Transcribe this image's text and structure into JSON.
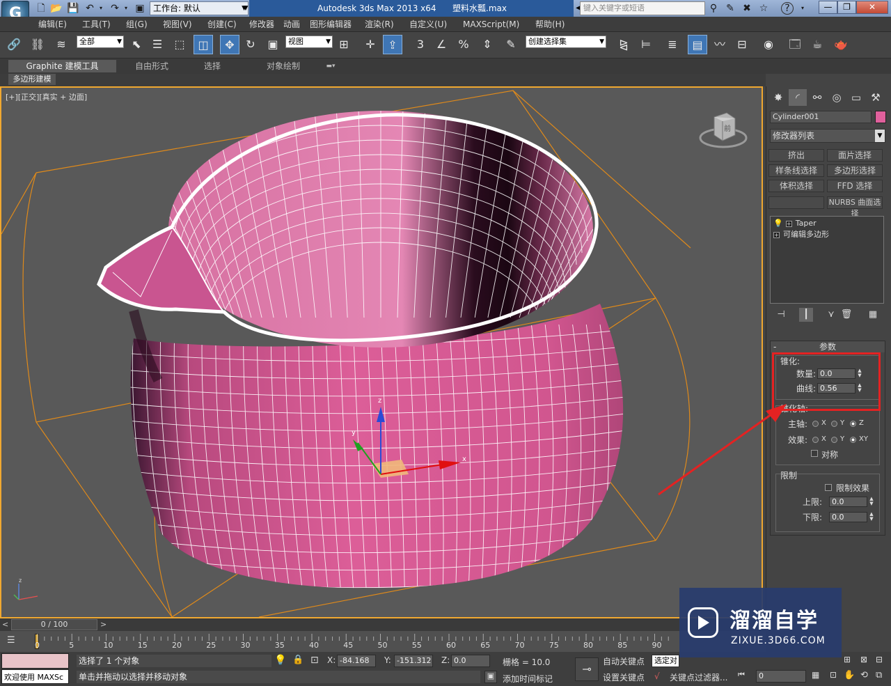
{
  "titlebar": {
    "workspace_label": "工作台: 默认",
    "app_name": "Autodesk 3ds Max  2013 x64",
    "file_name": "塑料水瓢.max",
    "search_placeholder": "键入关键字或短语",
    "minimize": "—",
    "restore": "❐",
    "close": "✕"
  },
  "menu": [
    "编辑(E)",
    "工具(T)",
    "组(G)",
    "视图(V)",
    "创建(C)",
    "修改器",
    "动画",
    "图形编辑器",
    "渲染(R)",
    "自定义(U)",
    "MAXScript(M)",
    "帮助(H)"
  ],
  "toolbar": {
    "selection_filter": "全部",
    "ref_coord": "视图",
    "named_selection": "创建选择集",
    "snap_label": "3",
    "angle_snap_label": "%"
  },
  "ribbon": {
    "tabs": [
      "Graphite 建模工具",
      "自由形式",
      "选择",
      "对象绘制"
    ],
    "sub_panel": "多边形建模"
  },
  "viewport": {
    "label": "[+][正交][真实 + 边面]",
    "viewcube_face": "前",
    "axis_x": "x",
    "axis_y": "y",
    "axis_z": "z"
  },
  "command_panel": {
    "object_name": "Cylinder001",
    "object_color": "#e0609c",
    "modifier_list": "修改器列表",
    "modifier_buttons": [
      "挤出",
      "面片选择",
      "样条线选择",
      "多边形选择",
      "体积选择",
      "FFD 选择",
      "",
      "NURBS 曲面选择"
    ],
    "stack": [
      "Taper",
      "可编辑多边形"
    ],
    "params": {
      "title": "参数",
      "taper_group": "锥化:",
      "amount_label": "数量:",
      "amount_value": "0.0",
      "curve_label": "曲线:",
      "curve_value": "0.56",
      "axis_group": "锥化轴:",
      "primary_label": "主轴:",
      "effect_label": "效果:",
      "x": "X",
      "y": "Y",
      "z": "Z",
      "xy": "XY",
      "symmetry_label": "对称",
      "limits_group": "限制",
      "limit_effect_label": "限制效果",
      "upper_label": "上限:",
      "upper_value": "0.0",
      "lower_label": "下限:",
      "lower_value": "0.0"
    }
  },
  "timeline": {
    "frame_display": "0 / 100",
    "prev": "<",
    "next": ">",
    "ticks": [
      "0",
      "5",
      "10",
      "15",
      "20",
      "25",
      "30",
      "35",
      "40",
      "45",
      "50",
      "55",
      "60",
      "65",
      "70",
      "75",
      "80",
      "85",
      "90"
    ]
  },
  "status": {
    "maxscript": "欢迎使用 MAXSc",
    "selection_text": "选择了 1 个对象",
    "prompt_text": "单击并拖动以选择并移动对象",
    "x_label": "X:",
    "x_value": "-84.168",
    "y_label": "Y:",
    "y_value": "-151.312",
    "z_label": "Z:",
    "z_value": "0.0",
    "grid_text": "栅格 = 10.0",
    "add_time_tag": "添加时间标记",
    "auto_key": "自动关键点",
    "selected_dropdown": "选定对",
    "set_key": "设置关键点",
    "key_filters": "关键点过滤器...",
    "frame_field": "0"
  },
  "watermark": {
    "title": "溜溜自学",
    "url": "ZIXUE.3D66.COM"
  }
}
